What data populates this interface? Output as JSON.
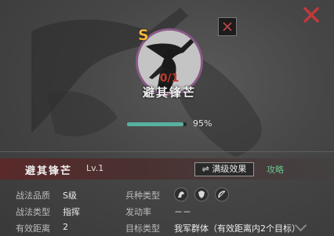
{
  "skill": {
    "grade_badge": "S",
    "count": "0/1",
    "name": "避其锋芒",
    "progress_value": 0.95,
    "progress_text": "95%",
    "level": "Lv.1"
  },
  "actions": {
    "max_level_effect": "⇌ 满级效果",
    "strategy": "攻略"
  },
  "info": {
    "quality_label": "战法品质",
    "quality_value": "S级",
    "type_label": "战法类型",
    "type_value": "指挥",
    "range_label": "有效距离",
    "range_value": "2",
    "troop_label": "兵种类型",
    "troop_icons": [
      "cavalry-icon",
      "shield-icon",
      "bow-icon"
    ],
    "rate_label": "发动率",
    "rate_value": "－－",
    "target_label": "目标类型",
    "target_value": "我军群体（有效距离内2个目标）"
  },
  "colors": {
    "accent_green": "#58b0a0",
    "grade_gold": "#f0b23a",
    "close_red": "#c0393a"
  }
}
